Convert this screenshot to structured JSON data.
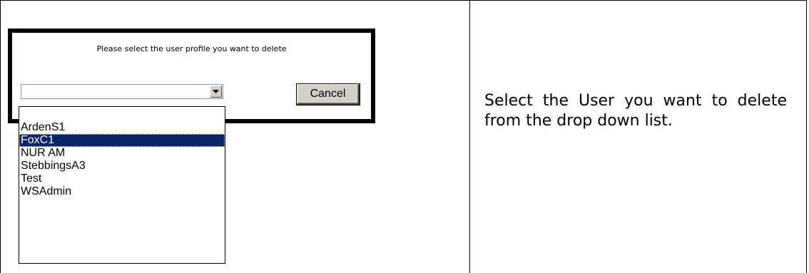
{
  "dialog": {
    "prompt": "Please select the user profile you want to delete",
    "user_select": {
      "value": "",
      "options": [
        "",
        "ArdenS1",
        "FoxC1",
        "NUR AM",
        "StebbingsA3",
        "Test",
        "WSAdmin"
      ],
      "highlighted": "FoxC1"
    },
    "cancel_label": "Cancel"
  },
  "instruction": {
    "text": "Select the User you want to delete from the drop down list."
  },
  "icons": {
    "combo_arrow": "chevron-down-icon"
  }
}
